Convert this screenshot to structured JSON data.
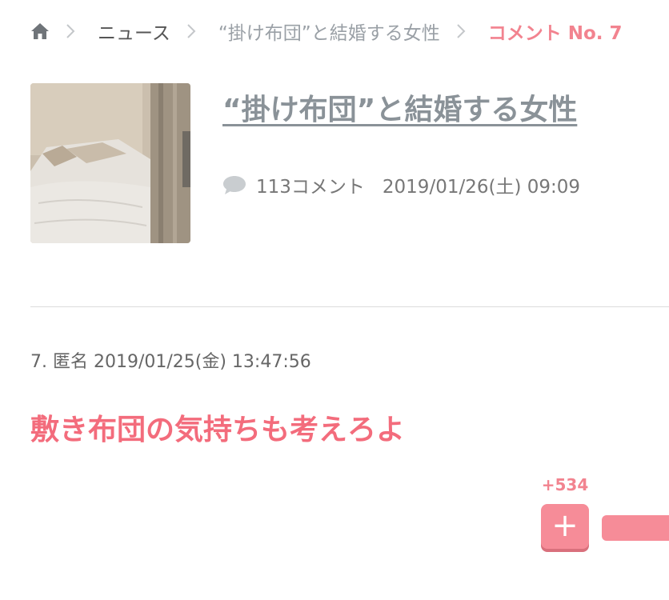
{
  "breadcrumb": {
    "home_icon": "home-icon",
    "items": [
      "ニュース",
      "“掛け布団”と結婚する女性"
    ],
    "current": "コメント No. 7"
  },
  "article": {
    "title": "“掛け布団”と結婚する女性",
    "comment_count": "113コメント",
    "date": "2019/01/26(土) 09:09"
  },
  "comment": {
    "header": "7. 匿名 2019/01/25(金) 13:47:56",
    "body": "敷き布団の気持ちも考えろよ",
    "plus_count": "+534",
    "plus_label": "+"
  },
  "colors": {
    "accent": "#f36c7c",
    "button": "#f68c98",
    "muted": "#9aa0a6"
  }
}
